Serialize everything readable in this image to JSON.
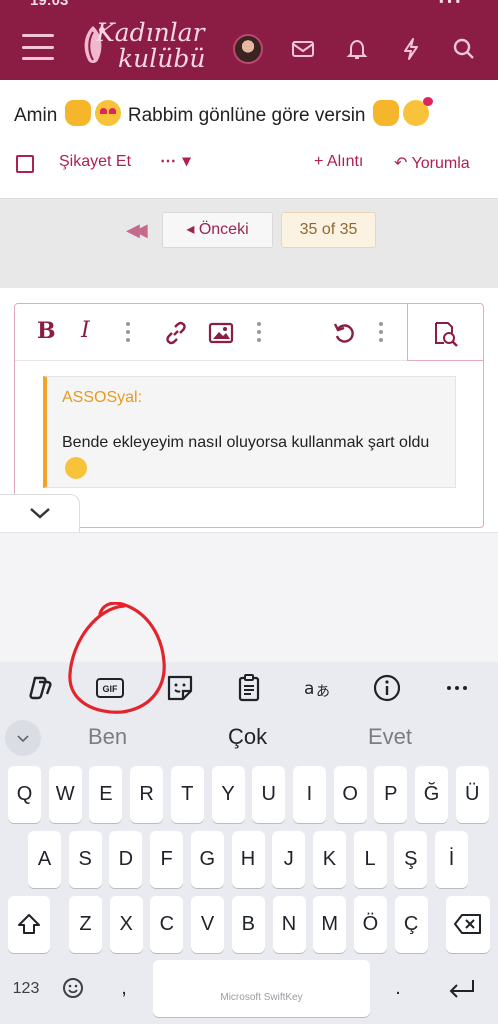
{
  "header": {
    "logo_line1": "Kadınlar",
    "logo_line2": "kulübü"
  },
  "post": {
    "text_before": "Amin",
    "text_middle": "Rabbim gönlüne göre versin",
    "report_label": "Şikayet Et",
    "more_label": "⋯ ▾",
    "quote_label": "+ Alıntı",
    "reply_label": "↶ Yorumla"
  },
  "pagination": {
    "first_symbol": "◀◀",
    "prev_label": "◂  Önceki",
    "current": "35 of 35"
  },
  "editor": {
    "quote_author": "ASSOSyal:",
    "quote_text": "Bende ekleyeyim nasıl oluyorsa kullanmak şart oldu"
  },
  "keyboard": {
    "suggestions": [
      "Ben",
      "Çok",
      "Evet"
    ],
    "row1": [
      "Q",
      "W",
      "E",
      "R",
      "T",
      "Y",
      "U",
      "I",
      "O",
      "P",
      "Ğ",
      "Ü"
    ],
    "row2": [
      "A",
      "S",
      "D",
      "F",
      "G",
      "H",
      "J",
      "K",
      "L",
      "Ş",
      "İ"
    ],
    "row3": [
      "Z",
      "X",
      "C",
      "V",
      "B",
      "N",
      "M",
      "Ö",
      "Ç"
    ],
    "num_label": "123",
    "comma": ",",
    "period": ".",
    "space_label": "Microsoft SwiftKey",
    "gif_label": "GIF"
  },
  "colors": {
    "brand": "#8b1c44",
    "accent": "#b01f52",
    "quote_bar": "#f1a32a",
    "annotation": "#e3242b"
  }
}
